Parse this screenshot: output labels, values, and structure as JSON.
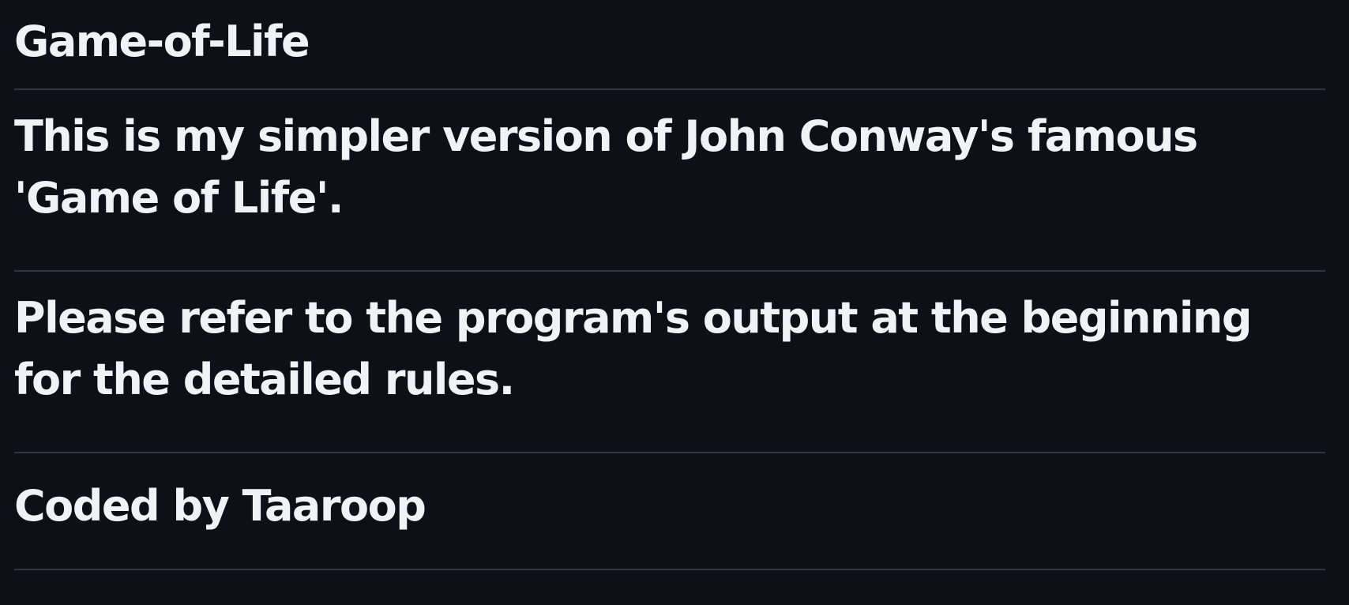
{
  "readme": {
    "title": "Game-of-Life",
    "description": "This is my simpler version of John Conway's famous 'Game of Life'.",
    "rules_note": "Please refer to the program's output at the beginning for the detailed rules.",
    "credit": "Coded by Taaroop"
  },
  "colors": {
    "background": "#0d1117",
    "text": "#f0f3f6",
    "divider": "#30363d"
  }
}
